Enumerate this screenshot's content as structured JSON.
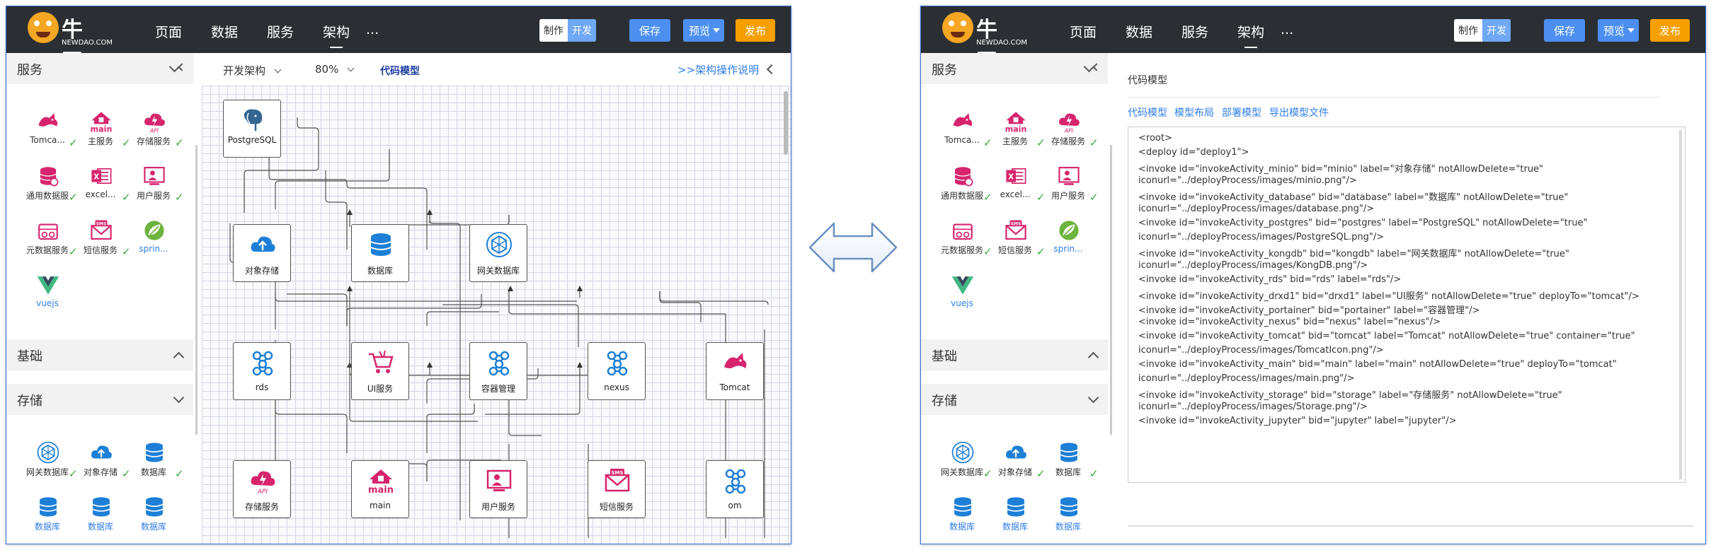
{
  "brand": {
    "name_cn": "牛刀",
    "name_en": "NEWDAO.COM"
  },
  "nav": [
    "页面",
    "数据",
    "服务",
    "架构",
    "..."
  ],
  "mode": {
    "make": "制作",
    "dev": "开发"
  },
  "buttons": {
    "save": "保存",
    "preview": "预览",
    "publish": "发布"
  },
  "sidebar": {
    "services_title": "服务",
    "services": [
      {
        "label": "Tomca...",
        "icon": "tomcat-cat-icon",
        "checked": true
      },
      {
        "label": "主服务",
        "icon": "main-house-icon",
        "checked": true
      },
      {
        "label": "存储服务",
        "icon": "api-cloud-icon",
        "checked": true
      },
      {
        "label": "通用数据服",
        "icon": "database-gear-icon",
        "checked": true
      },
      {
        "label": "excel...",
        "icon": "excel-icon",
        "checked": true
      },
      {
        "label": "用户服务",
        "icon": "user-screen-icon",
        "checked": true
      },
      {
        "label": "元数据服务",
        "icon": "metadata-icon",
        "checked": true
      },
      {
        "label": "短信服务",
        "icon": "sms-envelope-icon",
        "checked": true
      },
      {
        "label": "sprin...",
        "icon": "spring-leaf-icon",
        "checked": false
      },
      {
        "label": "vuejs",
        "icon": "vue-logo-icon",
        "checked": false
      }
    ],
    "basic_title": "基础",
    "storage_title": "存储",
    "storage": [
      {
        "label": "网关数据库",
        "icon": "gateway-db-icon",
        "checked": true
      },
      {
        "label": "对象存储",
        "icon": "object-storage-icon",
        "checked": true
      },
      {
        "label": "数据库",
        "icon": "database-icon",
        "checked": true
      },
      {
        "label": "数据库",
        "icon": "database-icon",
        "checked": false
      },
      {
        "label": "数据库",
        "icon": "database-icon",
        "checked": false
      },
      {
        "label": "数据库",
        "icon": "database-icon",
        "checked": false
      }
    ]
  },
  "toolbar": {
    "arch": "开发架构",
    "zoom": "80%",
    "code_model": "代码模型",
    "help": ">>架构操作说明"
  },
  "diagram": {
    "nodes": [
      "PostgreSQL",
      "对象存储",
      "数据库",
      "网关数据库",
      "rds",
      "UI服务",
      "容器管理",
      "nexus",
      "Tomcat",
      "存储服务",
      "main",
      "用户服务",
      "短信服务",
      "om"
    ]
  },
  "code_panel": {
    "title": "代码模型",
    "tabs": [
      "代码模型",
      "模型布局",
      "部署模型",
      "导出模型文件"
    ],
    "lines": [
      "<root>",
      "    <deploy  id=\"deploy1\">",
      "        <invoke  id=\"invokeActivity_minio\" bid=\"minio\" label=\"对象存储\" notAllowDelete=\"true\"",
      "iconurl=\"../deployProcess/images/minio.png\"/>",
      "        <invoke  id=\"invokeActivity_database\" bid=\"database\" label=\"数据库\" notAllowDelete=\"true\"",
      "iconurl=\"../deployProcess/images/database.png\"/>",
      "        <invoke  id=\"invokeActivity_postgres\" bid=\"postgres\" label=\"PostgreSQL\" notAllowDelete=\"true\"",
      "iconurl=\"../deployProcess/images/PostgreSQL.png\"/>",
      "        <invoke  id=\"invokeActivity_kongdb\" bid=\"kongdb\" label=\"网关数据库\" notAllowDelete=\"true\"",
      "iconurl=\"../deployProcess/images/KongDB.png\"/>",
      "        <invoke  id=\"invokeActivity_rds\" bid=\"rds\" label=\"rds\"/>",
      "        <invoke  id=\"invokeActivity_drxd1\" bid=\"drxd1\" label=\"UI服务\" notAllowDelete=\"true\" deployTo=\"tomcat\"/>",
      "        <invoke  id=\"invokeActivity_portainer\" bid=\"portainer\" label=\"容器管理\"/>",
      "        <invoke  id=\"invokeActivity_nexus\" bid=\"nexus\" label=\"nexus\"/>",
      "        <invoke  id=\"invokeActivity_tomcat\" bid=\"tomcat\" label=\"Tomcat\" notAllowDelete=\"true\" container=\"true\"",
      "iconurl=\"../deployProcess/images/TomcatIcon.png\"/>",
      "        <invoke  id=\"invokeActivity_main\" bid=\"main\" label=\"main\" notAllowDelete=\"true\" deployTo=\"tomcat\"",
      "iconurl=\"../deployProcess/images/main.png\"/>",
      "        <invoke  id=\"invokeActivity_storage\" bid=\"storage\" label=\"存储服务\" notAllowDelete=\"true\"",
      "iconurl=\"../deployProcess/images/Storage.png\"/>",
      "        <invoke  id=\"invokeActivity_jupyter\" bid=\"jupyter\" label=\"jupyter\"/>"
    ]
  },
  "colors": {
    "accent_blue": "#4c8ff0",
    "publish_orange": "#f5a000",
    "icon_pink": "#d6246e",
    "db_blue": "#1e7fd6",
    "topbar": "#2b2f33"
  }
}
